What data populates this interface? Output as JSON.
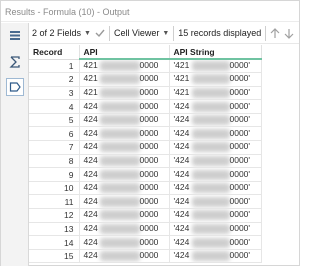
{
  "window": {
    "title": "Results - Formula (10) - Output"
  },
  "toolbar": {
    "fields_label": "2 of 2 Fields",
    "viewer_label": "Cell Viewer",
    "records_label": "15 records displayed"
  },
  "table": {
    "columns": [
      "Record",
      "API",
      "API String"
    ],
    "rows": [
      {
        "record": "1",
        "api_prefix": "421",
        "api_suffix": "0000",
        "str_prefix": "'421",
        "str_suffix": "0000'"
      },
      {
        "record": "2",
        "api_prefix": "421",
        "api_suffix": "0000",
        "str_prefix": "'421",
        "str_suffix": "0000'"
      },
      {
        "record": "3",
        "api_prefix": "421",
        "api_suffix": "0000",
        "str_prefix": "'421",
        "str_suffix": "0000'"
      },
      {
        "record": "4",
        "api_prefix": "424",
        "api_suffix": "0000",
        "str_prefix": "'424",
        "str_suffix": "0000'"
      },
      {
        "record": "5",
        "api_prefix": "424",
        "api_suffix": "0000",
        "str_prefix": "'424",
        "str_suffix": "0000'"
      },
      {
        "record": "6",
        "api_prefix": "424",
        "api_suffix": "0000",
        "str_prefix": "'424",
        "str_suffix": "0000'"
      },
      {
        "record": "7",
        "api_prefix": "424",
        "api_suffix": "0000",
        "str_prefix": "'424",
        "str_suffix": "0000'"
      },
      {
        "record": "8",
        "api_prefix": "424",
        "api_suffix": "0000",
        "str_prefix": "'424",
        "str_suffix": "0000'"
      },
      {
        "record": "9",
        "api_prefix": "424",
        "api_suffix": "0000",
        "str_prefix": "'424",
        "str_suffix": "0000'"
      },
      {
        "record": "10",
        "api_prefix": "424",
        "api_suffix": "0000",
        "str_prefix": "'424",
        "str_suffix": "0000'"
      },
      {
        "record": "11",
        "api_prefix": "424",
        "api_suffix": "0000",
        "str_prefix": "'424",
        "str_suffix": "0000'"
      },
      {
        "record": "12",
        "api_prefix": "424",
        "api_suffix": "0000",
        "str_prefix": "'424",
        "str_suffix": "0000'"
      },
      {
        "record": "13",
        "api_prefix": "424",
        "api_suffix": "0000",
        "str_prefix": "'424",
        "str_suffix": "0000'"
      },
      {
        "record": "14",
        "api_prefix": "424",
        "api_suffix": "0000",
        "str_prefix": "'424",
        "str_suffix": "0000'"
      },
      {
        "record": "15",
        "api_prefix": "424",
        "api_suffix": "0000",
        "str_prefix": "'424",
        "str_suffix": "0000'"
      }
    ]
  },
  "icons": {
    "side": [
      "table-view-icon",
      "formula-sigma-icon",
      "tag-shape-icon"
    ],
    "toolbar": [
      "checkmark-icon",
      "chevron-down-icon",
      "arrow-up-icon",
      "arrow-down-icon"
    ]
  },
  "colors": {
    "column_header_accent": "#6fc3a1",
    "active_side_border": "#9fb9d3"
  }
}
